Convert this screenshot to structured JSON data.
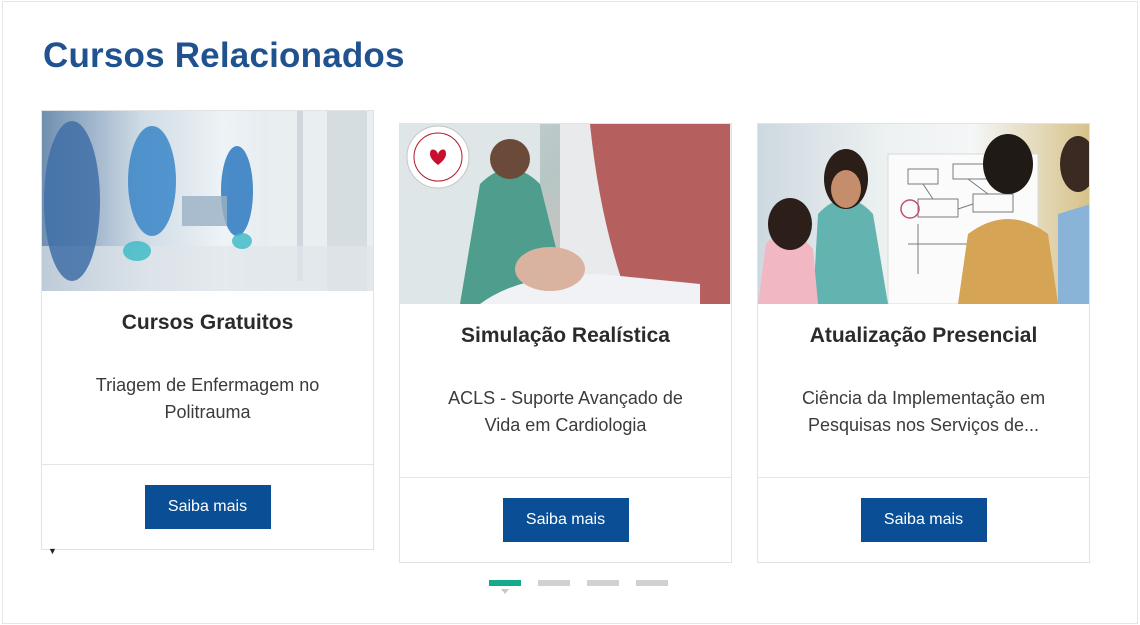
{
  "section": {
    "title": "Cursos Relacionados"
  },
  "cards": [
    {
      "category": "Cursos Gratuitos",
      "course": "Triagem de Enfermagem no Politrauma",
      "button": "Saiba mais",
      "image": "emergency-corridor-photo"
    },
    {
      "category": "Simulação Realística",
      "course": "ACLS - Suporte Avançado de Vida em Cardiologia",
      "button": "Saiba mais",
      "image": "cpr-simulation-photo"
    },
    {
      "category": "Atualização Presencial",
      "course": "Ciência da Implementação em Pesquisas nos Serviços de...",
      "button": "Saiba mais",
      "image": "whiteboard-meeting-photo"
    }
  ],
  "carousel": {
    "page_count": 4,
    "active_index": 0
  },
  "colors": {
    "title": "#20528f",
    "button": "#0a4f95",
    "active_dot": "#17a98b",
    "inactive_dot": "#d1d1d1"
  }
}
